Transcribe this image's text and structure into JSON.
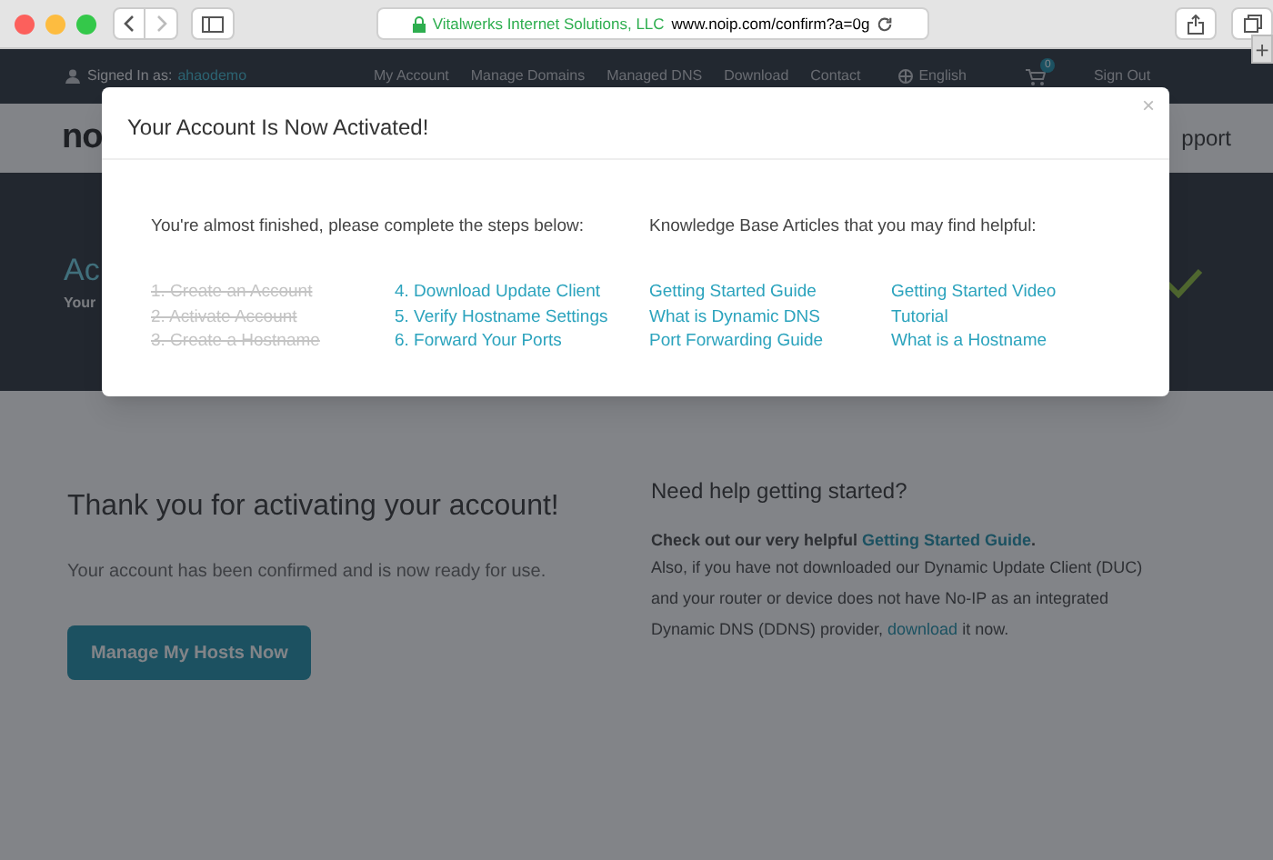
{
  "browser": {
    "site_owner": "Vitalwerks Internet Solutions, LLC",
    "url": "www.noip.com/confirm?a=0g",
    "new_tab": "+"
  },
  "top_nav": {
    "signed_in_label": "Signed In as:",
    "username": "ahaodemo",
    "links": [
      "My Account",
      "Manage Domains",
      "Managed DNS",
      "Download",
      "Contact"
    ],
    "language": "English",
    "cart_count": "0",
    "sign_out": "Sign Out"
  },
  "header": {
    "logo": "no",
    "menu_item": "pport"
  },
  "hero": {
    "title": "Ac",
    "subtitle": "Your"
  },
  "content": {
    "title": "Thank you for activating your account!",
    "text": "Your account has been confirmed and is now ready for use.",
    "button": "Manage My Hosts Now",
    "help_title": "Need help getting started?",
    "help_lead": "Check out our very helpful",
    "help_lead_link": "Getting Started Guide",
    "help_lead_end": ".",
    "help_body": "Also, if you have not downloaded our Dynamic Update Client (DUC) and your router or device does not have No-IP as an integrated Dynamic DNS (DDNS) provider,",
    "help_body_link": "download",
    "help_body_end": "it now."
  },
  "modal": {
    "title": "Your Account Is Now Activated!",
    "close": "×",
    "steps_intro": "You're almost finished, please complete the steps below:",
    "articles_intro": "Knowledge Base Articles that you may find helpful:",
    "steps": [
      {
        "label": "1. Create an Account",
        "done": true
      },
      {
        "label": "2. Activate Account",
        "done": true
      },
      {
        "label": "3. Create a Hostname",
        "done": true
      },
      {
        "label": "4. Download Update Client",
        "done": false
      },
      {
        "label": "5. Verify Hostname Settings",
        "done": false
      },
      {
        "label": "6. Forward Your Ports",
        "done": false
      }
    ],
    "articles": [
      [
        "Getting Started Guide",
        "What is Dynamic DNS",
        "Port Forwarding Guide"
      ],
      [
        "Getting Started Video",
        "Tutorial",
        "What is a Hostname"
      ]
    ]
  }
}
